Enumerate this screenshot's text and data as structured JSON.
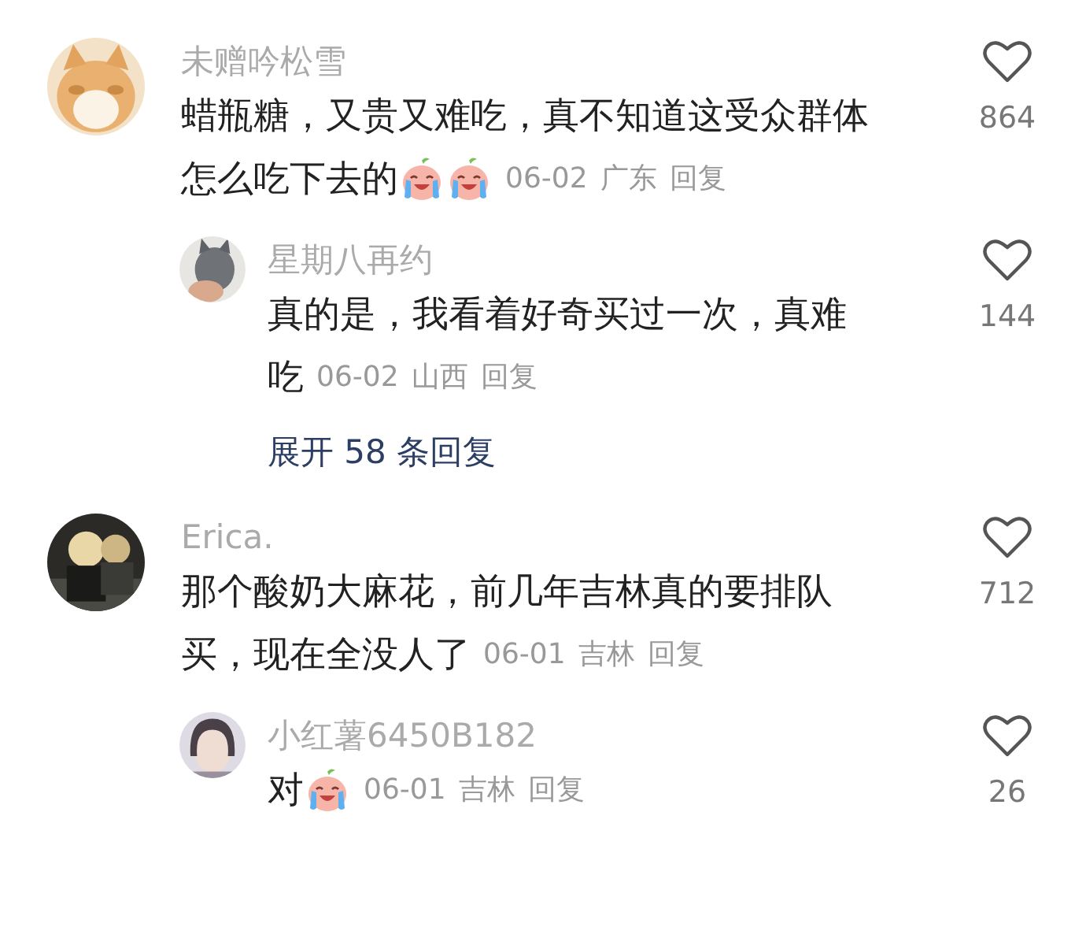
{
  "comments": [
    {
      "avatar": {
        "kind": "picture"
      },
      "user": "未赠吟松雪",
      "lines": [
        [
          {
            "kind": "text",
            "text": "蜡瓶糖，又贵又难吃，真不知道这受众群体"
          }
        ],
        [
          {
            "kind": "text",
            "text": "怎么吃下去的"
          },
          {
            "kind": "emoji"
          },
          {
            "kind": "emoji"
          }
        ]
      ],
      "date": "06-02",
      "region": "广东",
      "reply": "回复",
      "likes": "864",
      "liked": false,
      "replies": [
        {
          "avatar": {
            "kind": "picture"
          },
          "user": "星期八再约",
          "lines": [
            [
              {
                "kind": "text",
                "text": "真的是，我看着好奇买过一次，真难"
              }
            ],
            [
              {
                "kind": "text",
                "text": "吃"
              }
            ]
          ],
          "date": "06-02",
          "region": "山西",
          "reply": "回复",
          "likes": "144",
          "liked": false
        }
      ],
      "expand": "展开 58 条回复"
    },
    {
      "avatar": {
        "kind": "picture"
      },
      "user": "Erica.",
      "lines": [
        [
          {
            "kind": "text",
            "text": "那个酸奶大麻花，前几年吉林真的要排队"
          }
        ],
        [
          {
            "kind": "text",
            "text": "买，现在全没人了"
          }
        ]
      ],
      "date": "06-01",
      "region": "吉林",
      "reply": "回复",
      "likes": "712",
      "liked": false,
      "replies": [
        {
          "avatar": {
            "kind": "picture"
          },
          "user": "小红薯6450B182",
          "lines": [
            [
              {
                "kind": "text",
                "text": "对"
              },
              {
                "kind": "emoji"
              }
            ]
          ],
          "date": "06-01",
          "region": "吉林",
          "reply": "回复",
          "likes": "26",
          "liked": false
        }
      ]
    }
  ]
}
